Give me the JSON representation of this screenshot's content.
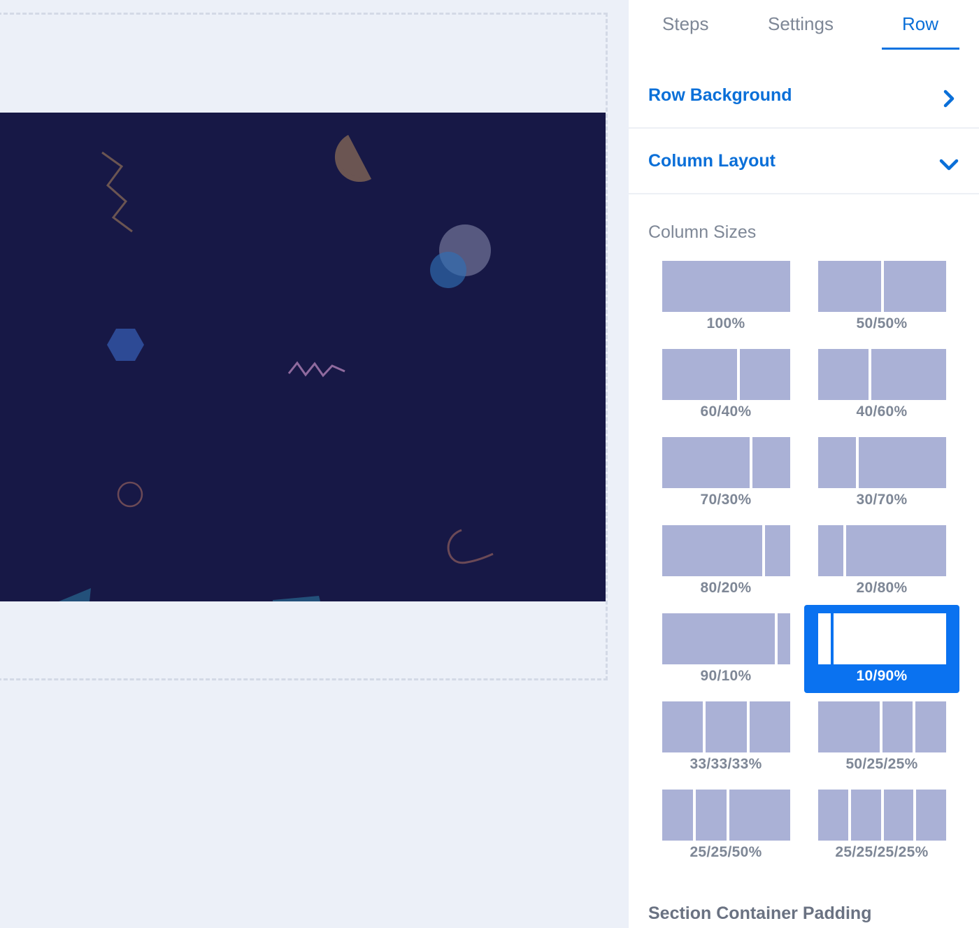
{
  "tabs": {
    "steps": "Steps",
    "settings": "Settings",
    "row": "Row"
  },
  "accordions": {
    "row_background": "Row Background",
    "column_layout": "Column Layout"
  },
  "column_sizes_label": "Column Sizes",
  "layouts": [
    {
      "label": "100%",
      "cols": [
        100
      ]
    },
    {
      "label": "50/50%",
      "cols": [
        50,
        50
      ]
    },
    {
      "label": "60/40%",
      "cols": [
        60,
        40
      ]
    },
    {
      "label": "40/60%",
      "cols": [
        40,
        60
      ]
    },
    {
      "label": "70/30%",
      "cols": [
        70,
        30
      ]
    },
    {
      "label": "30/70%",
      "cols": [
        30,
        70
      ]
    },
    {
      "label": "80/20%",
      "cols": [
        80,
        20
      ]
    },
    {
      "label": "20/80%",
      "cols": [
        20,
        80
      ]
    },
    {
      "label": "90/10%",
      "cols": [
        90,
        10
      ]
    },
    {
      "label": "10/90%",
      "cols": [
        10,
        90
      ]
    },
    {
      "label": "33/33/33%",
      "cols": [
        33,
        33,
        33
      ]
    },
    {
      "label": "50/25/25%",
      "cols": [
        50,
        25,
        25
      ]
    },
    {
      "label": "25/25/50%",
      "cols": [
        25,
        25,
        50
      ]
    },
    {
      "label": "25/25/25/25%",
      "cols": [
        25,
        25,
        25,
        25
      ]
    }
  ],
  "selected_layout": "10/90%",
  "section_container_padding_label": "Section Container Padding",
  "colors": {
    "accent": "#0a72f0",
    "row_background": "#171846",
    "column_bar": "#aab1d6"
  }
}
